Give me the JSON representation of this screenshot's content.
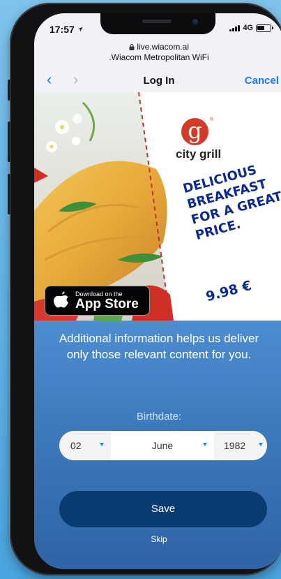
{
  "status_bar": {
    "time": "17:57",
    "network": "4G"
  },
  "browser": {
    "url": "live.wiacom.ai",
    "network_name": ".Wiacom Metropolitan WiFi",
    "title": "Log In",
    "cancel_label": "Cancel",
    "back_glyph": "‹",
    "forward_glyph": "›"
  },
  "ad": {
    "logo_letter": "g",
    "logo_reg": "®",
    "brand": "city grill",
    "headline_lines": [
      "DELICIOUS",
      "BREAKFAST",
      "FOR A GREAT",
      "PRICE."
    ],
    "price": "9.98 €",
    "appstore_small": "Download on the",
    "appstore_big": "App Store",
    "colors": {
      "headline": "#0b2a8f",
      "logo": "#d23a2a"
    }
  },
  "form": {
    "info_text": "Additional information helps us deliver only those relevant content for you.",
    "birthdate_label": "Birthdate:",
    "day": "02",
    "month": "June",
    "year": "1982",
    "save_label": "Save",
    "skip_label": "Skip"
  },
  "icons": [
    "lock-icon",
    "location-arrow-icon",
    "signal-bars-icon",
    "battery-icon",
    "apple-logo-icon",
    "dropdown-arrow-icon"
  ]
}
